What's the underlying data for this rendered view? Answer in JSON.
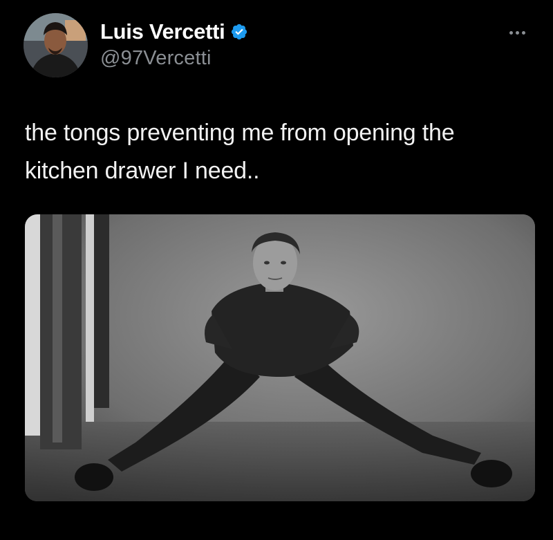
{
  "tweet": {
    "author": {
      "display_name": "Luis Vercetti",
      "handle": "@97Vercetti",
      "verified": true,
      "avatar_icon": "profile-photo"
    },
    "text_lines": [
      "the tongs preventing me from opening the",
      "kitchen drawer I need.."
    ],
    "more_icon": "ellipsis-icon",
    "media": {
      "type": "photo",
      "style": "black-and-white"
    }
  },
  "colors": {
    "background": "#000000",
    "name": "#ffffff",
    "handle": "#8b8f94",
    "verified": "#1d9bf0",
    "text": "#f2f2f2"
  }
}
